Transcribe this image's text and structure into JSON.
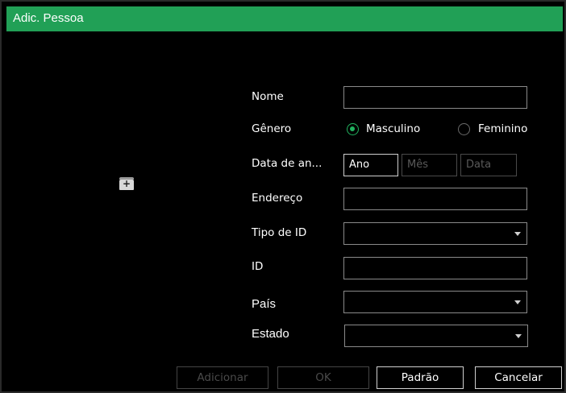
{
  "dialog": {
    "title": "Adic. Pessoa"
  },
  "form": {
    "name": {
      "label": "Nome",
      "value": ""
    },
    "gender": {
      "label": "Gênero",
      "options": [
        "Masculino",
        "Feminino"
      ],
      "selected": "Masculino"
    },
    "birthdate": {
      "label": "Data de an...",
      "year_placeholder": "Ano",
      "month_placeholder": "Mês",
      "day_placeholder": "Data"
    },
    "address": {
      "label": "Endereço",
      "value": ""
    },
    "id_type": {
      "label": "Tipo de ID",
      "value": ""
    },
    "id": {
      "label": "ID",
      "value": ""
    },
    "country": {
      "label": "País",
      "value": ""
    },
    "state": {
      "label": "Estado",
      "value": ""
    }
  },
  "icons": {
    "add_photo": "add-photo-icon",
    "add_photo_glyph": "+"
  },
  "buttons": {
    "add": "Adicionar",
    "ok": "OK",
    "default": "Padrão",
    "cancel": "Cancelar"
  },
  "colors": {
    "accent": "#21a056",
    "background": "#000000"
  }
}
